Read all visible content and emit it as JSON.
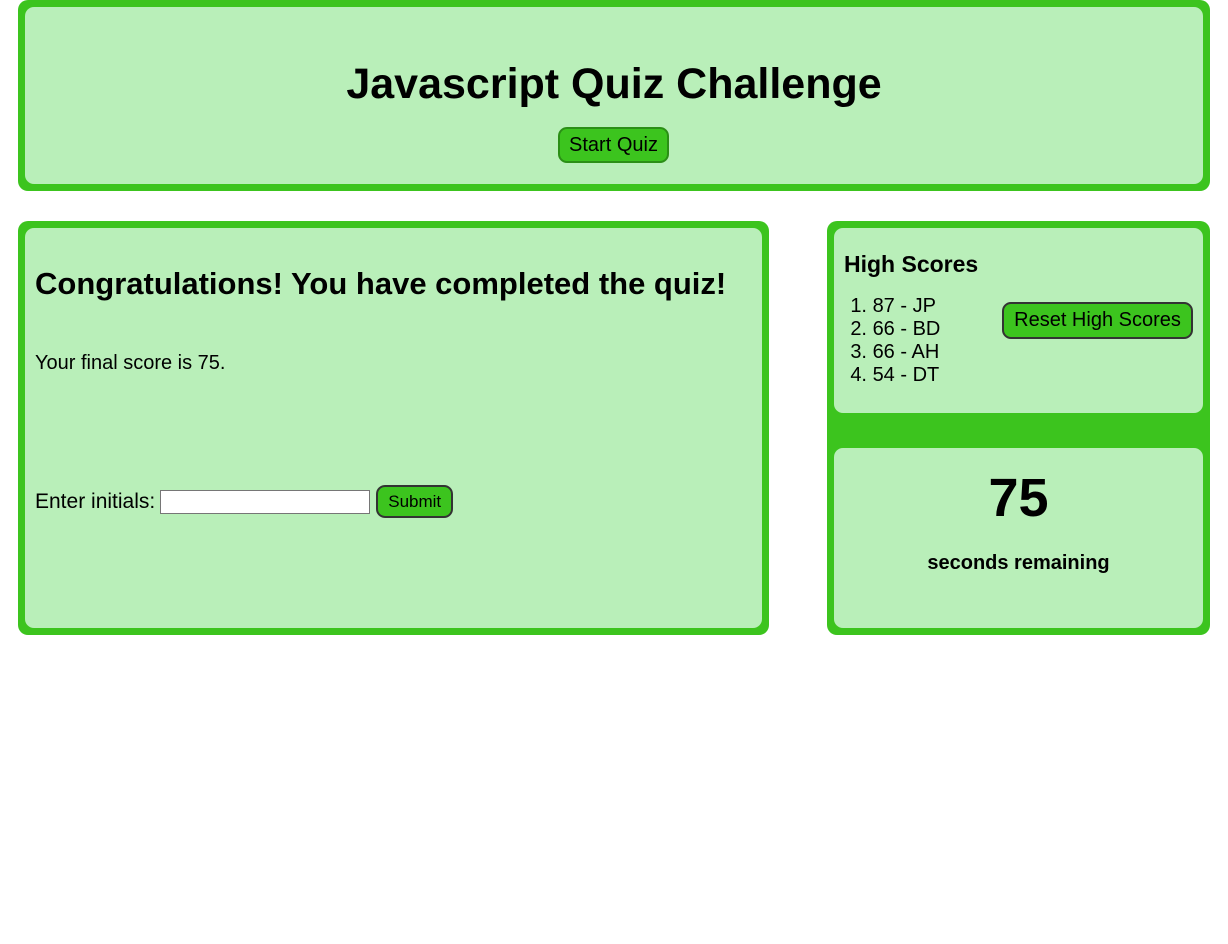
{
  "header": {
    "title": "Javascript Quiz Challenge",
    "start_label": "Start Quiz"
  },
  "quiz": {
    "heading": "Congratulations! You have completed the quiz!",
    "score_text": "Your final score is 75.",
    "initials_label": "Enter initials:",
    "initials_value": "",
    "submit_label": "Submit"
  },
  "high_scores": {
    "title": "High Scores",
    "entries": [
      {
        "rank": "1.",
        "text": "87 - JP"
      },
      {
        "rank": "2.",
        "text": "66 - BD"
      },
      {
        "rank": "3.",
        "text": "66 - AH"
      },
      {
        "rank": "4.",
        "text": "54 - DT"
      }
    ],
    "reset_label": "Reset High Scores"
  },
  "timer": {
    "value": "75",
    "label": "seconds remaining"
  },
  "colors": {
    "panel_border": "#3cc41e",
    "panel_fill": "#b9efb9",
    "button_fill": "#3cc41e"
  }
}
